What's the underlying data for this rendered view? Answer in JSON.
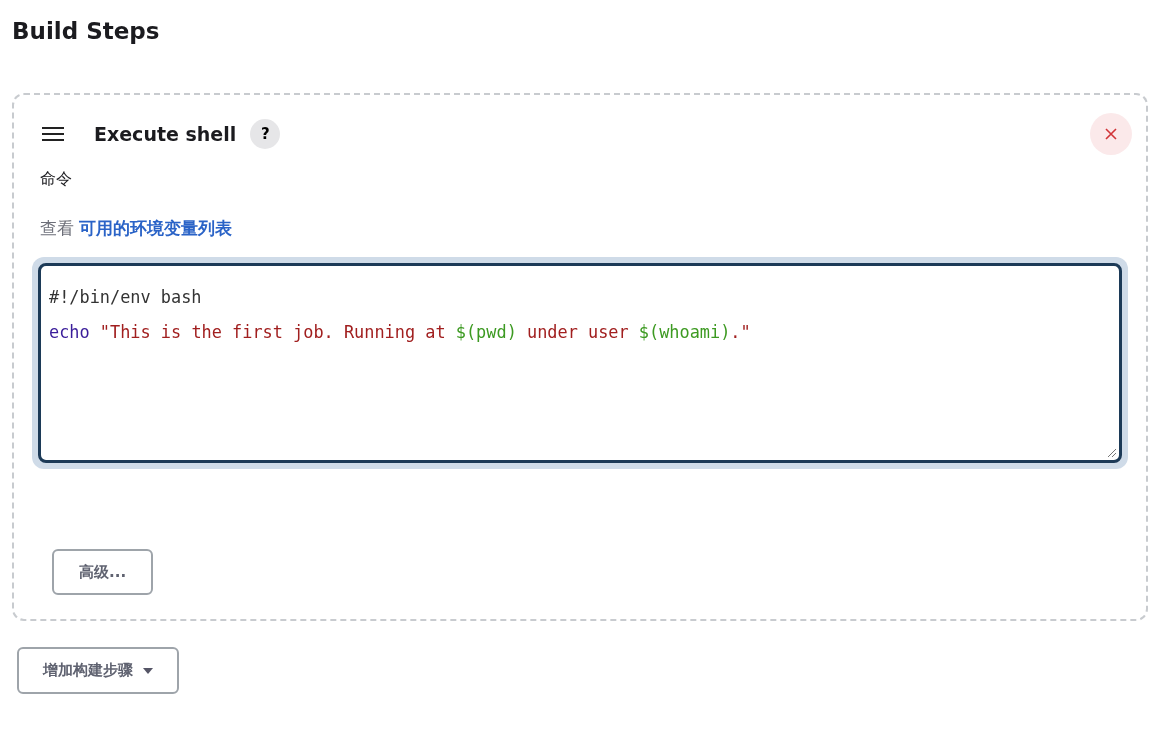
{
  "heading": "Build Steps",
  "step": {
    "title": "Execute shell",
    "help": "?",
    "field_label": "命令",
    "help_prefix": "查看",
    "help_link": "可用的环境变量列表",
    "code_lines": [
      [
        {
          "kind": "comment",
          "text": "#!/bin/env bash"
        }
      ],
      [
        {
          "kind": "keyword",
          "text": "echo"
        },
        {
          "kind": "string",
          "text": " \"This is the first job. Running at "
        },
        {
          "kind": "subst",
          "text": "$(pwd)"
        },
        {
          "kind": "string",
          "text": " under user "
        },
        {
          "kind": "subst",
          "text": "$(whoami)"
        },
        {
          "kind": "string",
          "text": ".\""
        }
      ]
    ],
    "advanced_button": "高级..."
  },
  "add_step_button": "增加构建步骤"
}
